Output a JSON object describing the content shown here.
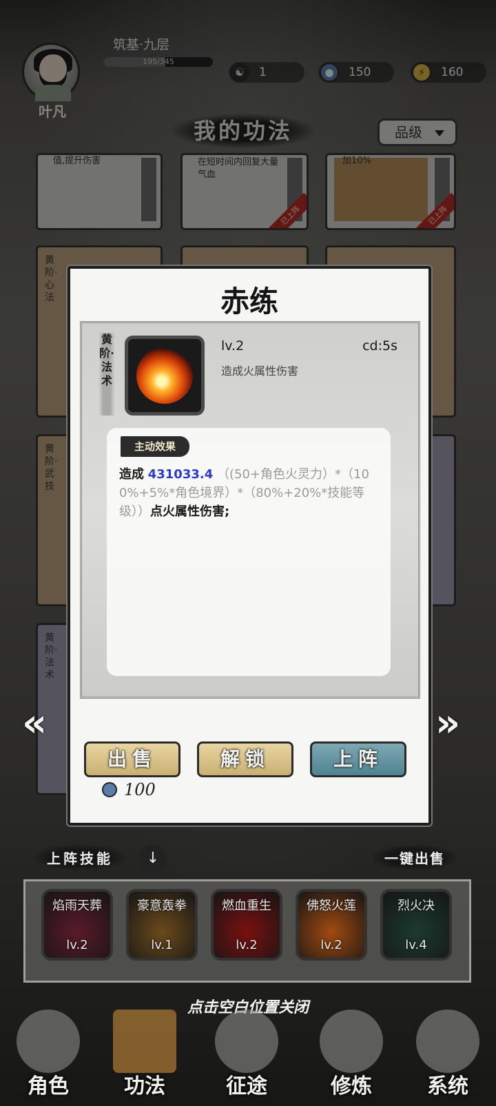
{
  "player": {
    "name": "叶凡",
    "realm": "筑基·九层",
    "exp_text": "195/345",
    "exp_fraction": 0.565
  },
  "resources": [
    {
      "icon": "yin-yang-icon",
      "value": "1"
    },
    {
      "icon": "water-drop-icon",
      "value": "150"
    },
    {
      "icon": "lightning-icon",
      "value": "160"
    }
  ],
  "page": {
    "title": "我的功法",
    "filter_label": "品级"
  },
  "bg_cards": {
    "row1": [
      {
        "text": "值,提升伤害",
        "ribbon": ""
      },
      {
        "text": "在短时间内回复大量气血",
        "ribbon": "已上阵"
      },
      {
        "text": "加10%",
        "ribbon": "已上阵"
      }
    ],
    "tags": [
      "黄阶·心法",
      "黄阶·武技",
      "黄阶·法术"
    ]
  },
  "modal": {
    "title": "赤练",
    "grade": "黄阶·法术",
    "level": "lv.2",
    "cooldown": "cd:5s",
    "description": "造成火属性伤害",
    "effect_label": "主动效果",
    "effect_prefix": "造成",
    "effect_value": "431033.4",
    "effect_formula": "（(50+角色火灵力）*（100%+5%*角色境界）*（80%+20%*技能等级））",
    "effect_suffix": "点火属性伤害;",
    "sell_label": "出售",
    "unlock_label": "解锁",
    "equip_label": "上阵",
    "sell_price": "100"
  },
  "nav_arrows": {
    "prev": "«",
    "next": "»"
  },
  "equipped": {
    "label": "上阵技能",
    "toggle": "↓",
    "quick_sell": "一键出售",
    "skills": [
      {
        "name": "焰雨天葬",
        "level": "lv.2",
        "color": "#5a1a2a"
      },
      {
        "name": "豪意轰拳",
        "level": "lv.1",
        "color": "#6b4a1c"
      },
      {
        "name": "燃血重生",
        "level": "lv.2",
        "color": "#7a1010"
      },
      {
        "name": "佛怒火莲",
        "level": "lv.2",
        "color": "#a24a10"
      },
      {
        "name": "烈火决",
        "level": "lv.4",
        "color": "#1c3a30"
      }
    ]
  },
  "close_hint": "点击空白位置关闭",
  "bottom_nav": [
    {
      "label": "角色",
      "icon": "character-icon"
    },
    {
      "label": "功法",
      "icon": "book-icon"
    },
    {
      "label": "征途",
      "icon": "sword-icon"
    },
    {
      "label": "修炼",
      "icon": "meditation-icon"
    },
    {
      "label": "系统",
      "icon": "settings-icon"
    }
  ]
}
